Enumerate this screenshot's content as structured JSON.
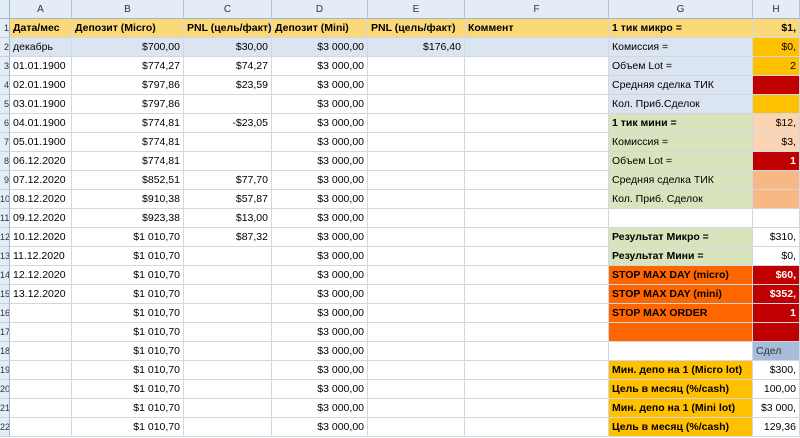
{
  "columns": [
    "A",
    "B",
    "C",
    "D",
    "E",
    "F",
    "G",
    "H"
  ],
  "header": {
    "num": "1",
    "a": "Дата/мес",
    "b": "Депозит (Micro)",
    "c": "PNL (цель/факт)",
    "d": "Депозит (Mini)",
    "e": "PNL (цель/факт)",
    "f": "Коммент",
    "g": "1 тик микро =",
    "h": "$1,"
  },
  "rows": [
    {
      "num": "2",
      "a": "декабрь",
      "b": "$700,00",
      "c": "$30,00",
      "d": "$3 000,00",
      "e": "$176,40",
      "g": "Комиссия =",
      "h": "$0,"
    },
    {
      "num": "3",
      "a": "01.01.1900",
      "b": "$774,27",
      "c": "$74,27",
      "d": "$3 000,00",
      "e": "",
      "g": "Объем  Lot =",
      "h": "2"
    },
    {
      "num": "4",
      "a": "02.01.1900",
      "b": "$797,86",
      "c": "$23,59",
      "d": "$3 000,00",
      "e": "",
      "g": "Средняя сделка ТИК",
      "h": ""
    },
    {
      "num": "5",
      "a": "03.01.1900",
      "b": "$797,86",
      "c": "",
      "d": "$3 000,00",
      "e": "",
      "g": "Кол. Приб.Сделок",
      "h": ""
    },
    {
      "num": "6",
      "a": "04.01.1900",
      "b": "$774,81",
      "c": "-$23,05",
      "d": "$3 000,00",
      "e": "",
      "g": "1 тик мини =",
      "h": "$12,"
    },
    {
      "num": "7",
      "a": "05.01.1900",
      "b": "$774,81",
      "c": "",
      "d": "$3 000,00",
      "e": "",
      "g": "Комиссия =",
      "h": "$3,"
    },
    {
      "num": "8",
      "a": "06.12.2020",
      "b": "$774,81",
      "c": "",
      "d": "$3 000,00",
      "e": "",
      "g": "Объем  Lot =",
      "h": "1"
    },
    {
      "num": "9",
      "a": "07.12.2020",
      "b": "$852,51",
      "c": "$77,70",
      "d": "$3 000,00",
      "e": "",
      "g": "Средняя сделка ТИК",
      "h": ""
    },
    {
      "num": "10",
      "a": "08.12.2020",
      "b": "$910,38",
      "c": "$57,87",
      "d": "$3 000,00",
      "e": "",
      "g": "Кол. Приб. Сделок",
      "h": ""
    },
    {
      "num": "11",
      "a": "09.12.2020",
      "b": "$923,38",
      "c": "$13,00",
      "d": "$3 000,00",
      "e": "",
      "g": "",
      "h": ""
    },
    {
      "num": "12",
      "a": "10.12.2020",
      "b": "$1 010,70",
      "c": "$87,32",
      "d": "$3 000,00",
      "e": "",
      "g": "Результат Микро =",
      "h": "$310,"
    },
    {
      "num": "13",
      "a": "11.12.2020",
      "b": "$1 010,70",
      "c": "",
      "d": "$3 000,00",
      "e": "",
      "g": "Результат Мини =",
      "h": "$0,"
    },
    {
      "num": "14",
      "a": "12.12.2020",
      "b": "$1 010,70",
      "c": "",
      "d": "$3 000,00",
      "e": "",
      "g": "STOP MAX DAY (micro)",
      "h": "$60,"
    },
    {
      "num": "15",
      "a": "13.12.2020",
      "b": "$1 010,70",
      "c": "",
      "d": "$3 000,00",
      "e": "",
      "g": "STOP MAX DAY (mini)",
      "h": "$352,"
    },
    {
      "num": "16",
      "a": "",
      "b": "$1 010,70",
      "c": "",
      "d": "$3 000,00",
      "e": "",
      "g": "STOP MAX ORDER",
      "h": "1"
    },
    {
      "num": "17",
      "a": "",
      "b": "$1 010,70",
      "c": "",
      "d": "$3 000,00",
      "e": "",
      "g": "",
      "h": ""
    },
    {
      "num": "18",
      "a": "",
      "b": "$1 010,70",
      "c": "",
      "d": "$3 000,00",
      "e": "",
      "g": "",
      "h": "Сдел"
    },
    {
      "num": "19",
      "a": "",
      "b": "$1 010,70",
      "c": "",
      "d": "$3 000,00",
      "e": "",
      "g": "Мин. депо на 1 (Micro lot)",
      "h": "$300,"
    },
    {
      "num": "20",
      "a": "",
      "b": "$1 010,70",
      "c": "",
      "d": "$3 000,00",
      "e": "",
      "g": "Цель в месяц (%/cash)",
      "h": "100,00"
    },
    {
      "num": "21",
      "a": "",
      "b": "$1 010,70",
      "c": "",
      "d": "$3 000,00",
      "e": "",
      "g": "Мин. депо на 1 (Mini lot)",
      "h": "$3 000,"
    },
    {
      "num": "22",
      "a": "",
      "b": "$1 010,70",
      "c": "",
      "d": "$3 000,00",
      "e": "",
      "g": "Цель в месяц (%/cash)",
      "h": "129,36"
    }
  ],
  "colors": {
    "header_yellow": "#fcd978",
    "blue": "#dbe5f1",
    "green": "#d7e4bc",
    "red": "#c00000",
    "orange": "#ff6600"
  }
}
